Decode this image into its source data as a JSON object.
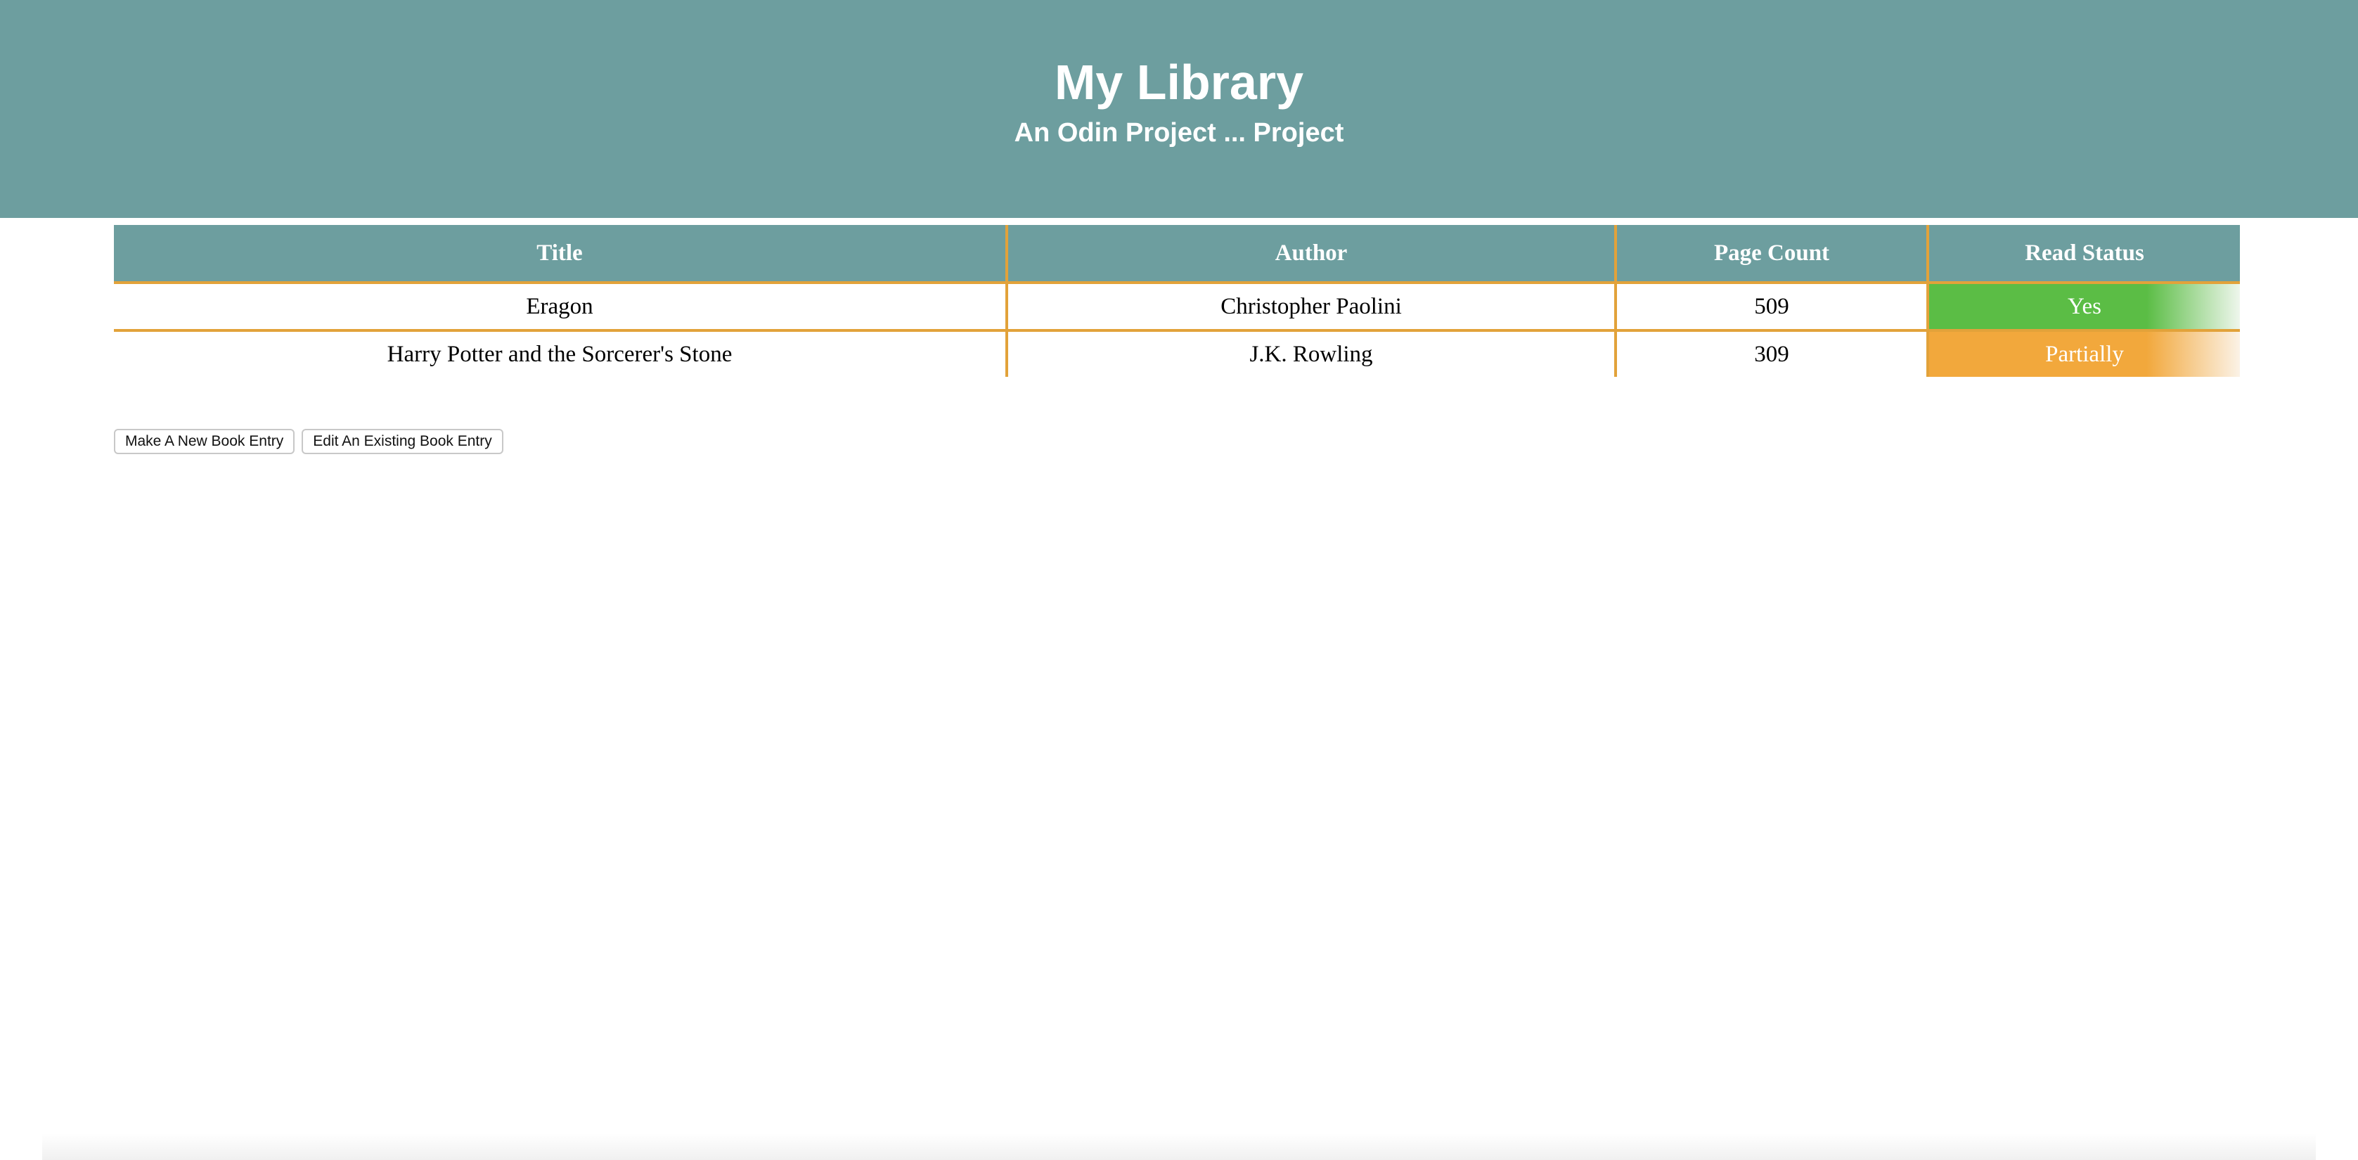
{
  "header": {
    "title": "My Library",
    "subtitle": "An Odin Project ... Project",
    "background_color": "#6d9e9f"
  },
  "table": {
    "columns": [
      "Title",
      "Author",
      "Page Count",
      "Read Status"
    ],
    "rows": [
      {
        "title": "Eragon",
        "author": "Christopher Paolini",
        "pages": "509",
        "status": "Yes",
        "status_color": "#5bbd45"
      },
      {
        "title": "Harry Potter and the Sorcerer's Stone",
        "author": "J.K. Rowling",
        "pages": "309",
        "status": "Partially",
        "status_color": "#f2a83c"
      }
    ],
    "border_color": "#e2a23a"
  },
  "buttons": {
    "new_entry": "Make A New Book Entry",
    "edit_entry": "Edit An Existing Book Entry"
  }
}
